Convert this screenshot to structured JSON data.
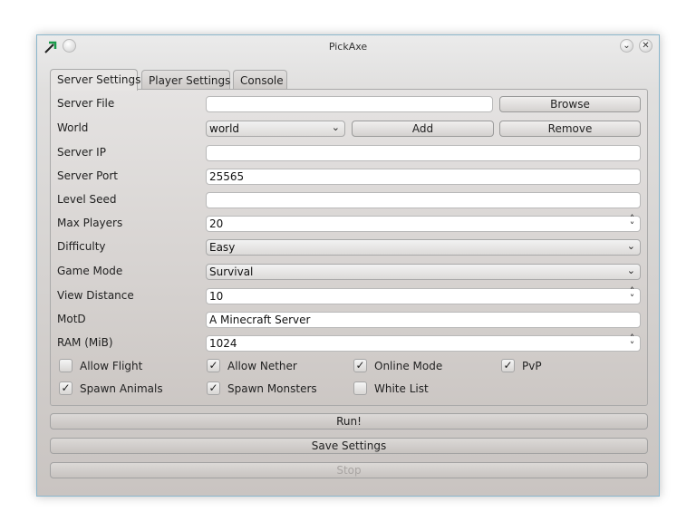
{
  "window": {
    "title": "PickAxe",
    "app_icon": "pickaxe-icon",
    "buttons": [
      "minimize",
      "close"
    ]
  },
  "tabs": [
    {
      "label": "Server Settings",
      "active": true
    },
    {
      "label": "Player Settings",
      "active": false
    },
    {
      "label": "Console",
      "active": false
    }
  ],
  "form": {
    "server_file": {
      "label": "Server File",
      "value": "",
      "browse_label": "Browse"
    },
    "world": {
      "label": "World",
      "selected": "world",
      "add_label": "Add",
      "remove_label": "Remove"
    },
    "server_ip": {
      "label": "Server IP",
      "value": ""
    },
    "server_port": {
      "label": "Server Port",
      "value": "25565"
    },
    "level_seed": {
      "label": "Level Seed",
      "value": ""
    },
    "max_players": {
      "label": "Max Players",
      "value": "20"
    },
    "difficulty": {
      "label": "Difficulty",
      "selected": "Easy"
    },
    "game_mode": {
      "label": "Game Mode",
      "selected": "Survival"
    },
    "view_distance": {
      "label": "View Distance",
      "value": "10"
    },
    "motd": {
      "label": "MotD",
      "value": "A Minecraft Server"
    },
    "ram": {
      "label": "RAM (MiB)",
      "value": "1024"
    }
  },
  "checkboxes": [
    {
      "label": "Allow Flight",
      "checked": false
    },
    {
      "label": "Allow Nether",
      "checked": true
    },
    {
      "label": "Online Mode",
      "checked": true
    },
    {
      "label": "PvP",
      "checked": true
    },
    {
      "label": "Spawn Animals",
      "checked": true
    },
    {
      "label": "Spawn Monsters",
      "checked": true
    },
    {
      "label": "White List",
      "checked": false
    }
  ],
  "actions": {
    "run_label": "Run!",
    "save_label": "Save Settings",
    "stop_label": "Stop",
    "stop_enabled": false
  }
}
